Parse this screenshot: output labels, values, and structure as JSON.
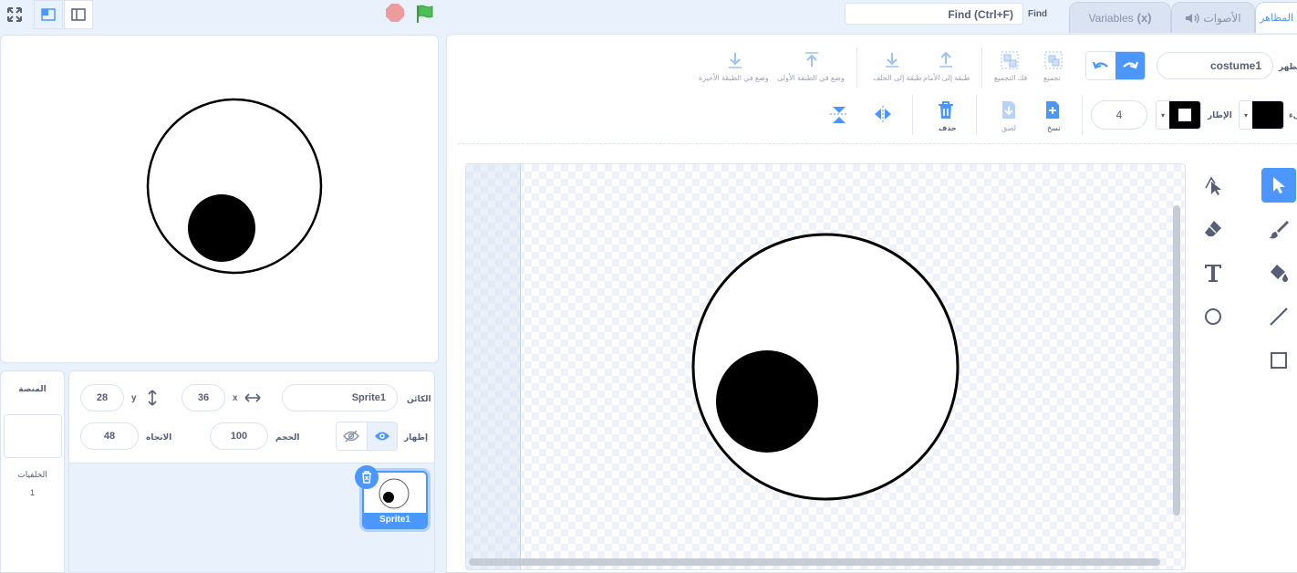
{
  "topbar": {
    "find_placeholder": "Find (Ctrl+F)",
    "find_label": "Find",
    "tabs": {
      "variables": "Variables",
      "variables_icon": "(x)",
      "sounds": "الأصوات",
      "costumes": "المظاهر"
    }
  },
  "sprite_info": {
    "sprite_label": "الكائن",
    "sprite_name": "Sprite1",
    "x_label": "x",
    "x_value": "36",
    "y_label": "y",
    "y_value": "28",
    "show_label": "إظهار",
    "size_label": "الحجم",
    "size_value": "100",
    "direction_label": "الاتجاه",
    "direction_value": "48"
  },
  "sprite_list": {
    "items": [
      {
        "name": "Sprite1"
      }
    ]
  },
  "stage_pane": {
    "title": "المنصة",
    "backdrops_label": "الخلفيات",
    "backdrops_count": "1"
  },
  "editor": {
    "costume_label": "المظهر",
    "costume_name": "costume1",
    "group_label": "تجميع",
    "ungroup_label": "فك التجميع",
    "forward_label": "طبقة إلى الأمام",
    "backward_label": "طبقة إلى الخلف",
    "front_label": "وضع في الطبقة الأولى",
    "back_label": "وضع في الطبقة الأخيرة",
    "fill_label": "ملء",
    "outline_label": "الإطار",
    "outline_width": "4",
    "copy_label": "نسخ",
    "paste_label": "لصق",
    "delete_label": "حذف"
  },
  "colors": {
    "accent": "#4c97ff",
    "background": "#e9f1fc",
    "text": "#575e75"
  }
}
